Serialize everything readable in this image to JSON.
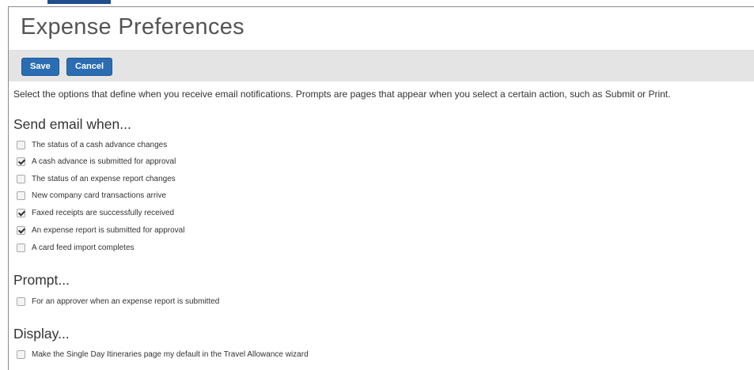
{
  "page": {
    "title": "Expense Preferences",
    "intro": "Select the options that define when you receive email notifications. Prompts are pages that appear when you select a certain action, such as Submit or Print."
  },
  "toolbar": {
    "save_label": "Save",
    "cancel_label": "Cancel",
    "accent_color": "#2a6db3",
    "bar_color": "#e4e4e4"
  },
  "sections": {
    "email": {
      "heading": "Send email when...",
      "options": [
        {
          "label": "The status of a cash advance changes",
          "checked": false
        },
        {
          "label": "A cash advance is submitted for approval",
          "checked": true
        },
        {
          "label": "The status of an expense report changes",
          "checked": false
        },
        {
          "label": "New company card transactions arrive",
          "checked": false
        },
        {
          "label": "Faxed receipts are successfully received",
          "checked": true
        },
        {
          "label": "An expense report is submitted for approval",
          "checked": true
        },
        {
          "label": "A card feed import completes",
          "checked": false
        }
      ]
    },
    "prompt": {
      "heading": "Prompt...",
      "options": [
        {
          "label": "For an approver when an expense report is submitted",
          "checked": false
        }
      ]
    },
    "display": {
      "heading": "Display...",
      "options": [
        {
          "label": "Make the Single Day Itineraries page my default in the Travel Allowance wizard",
          "checked": false
        }
      ]
    }
  }
}
